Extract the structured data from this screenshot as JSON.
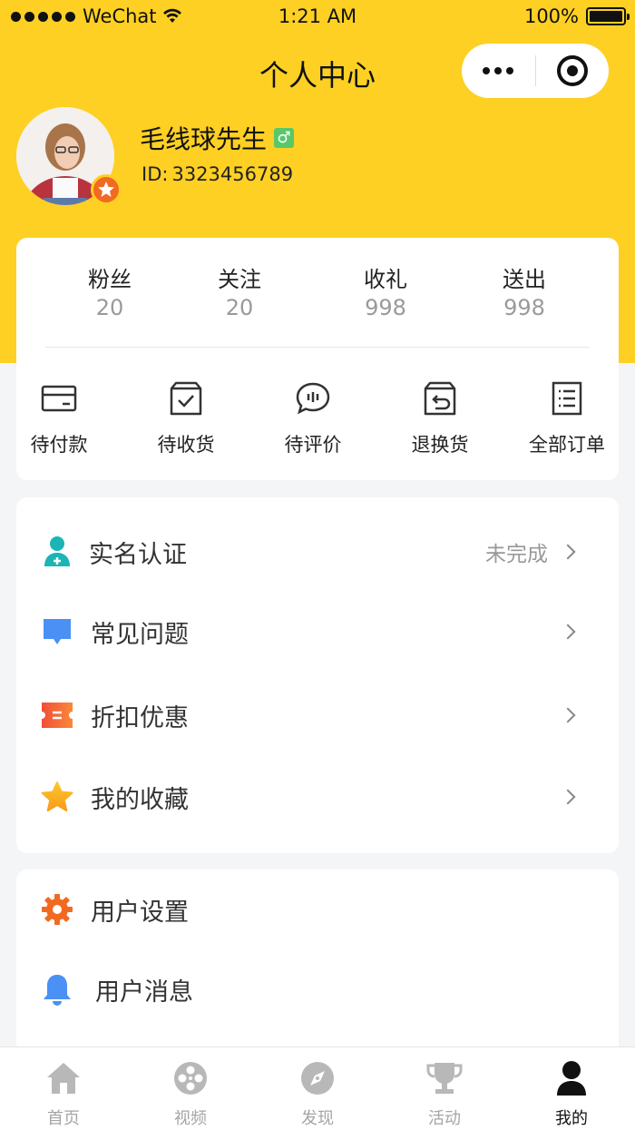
{
  "status_bar": {
    "carrier": "WeChat",
    "time": "1:21 AM",
    "battery": "100%"
  },
  "nav": {
    "title": "个人中心"
  },
  "profile": {
    "name": "毛线球先生",
    "gender_symbol": "♂",
    "id_label": "ID:",
    "id_value": "3323456789"
  },
  "stats": [
    {
      "label": "粉丝",
      "value": "20"
    },
    {
      "label": "关注",
      "value": "20"
    },
    {
      "label": "收礼",
      "value": "998"
    },
    {
      "label": "送出",
      "value": "998"
    }
  ],
  "orders": [
    {
      "label": "待付款",
      "icon": "wallet-icon"
    },
    {
      "label": "待收货",
      "icon": "box-check-icon"
    },
    {
      "label": "待评价",
      "icon": "comment-icon"
    },
    {
      "label": "退换货",
      "icon": "return-box-icon"
    },
    {
      "label": "全部订单",
      "icon": "list-icon"
    }
  ],
  "menu1": [
    {
      "label": "实名认证",
      "status": "未完成",
      "icon": "user-verify-icon"
    },
    {
      "label": "常见问题",
      "status": "",
      "icon": "chat-bubble-icon"
    },
    {
      "label": "折扣优惠",
      "status": "",
      "icon": "ticket-icon"
    },
    {
      "label": "我的收藏",
      "status": "",
      "icon": "star-icon"
    }
  ],
  "menu2": [
    {
      "label": "用户设置",
      "icon": "gear-icon"
    },
    {
      "label": "用户消息",
      "icon": "bell-icon"
    }
  ],
  "tabs": [
    {
      "label": "首页",
      "icon": "home-icon"
    },
    {
      "label": "视频",
      "icon": "film-reel-icon"
    },
    {
      "label": "发现",
      "icon": "compass-icon"
    },
    {
      "label": "活动",
      "icon": "trophy-icon"
    },
    {
      "label": "我的",
      "icon": "person-icon"
    }
  ],
  "colors": {
    "brand_yellow": "#fdd023",
    "accent_orange": "#f26a21",
    "teal": "#1bb5b5",
    "blue": "#4a90f5"
  }
}
